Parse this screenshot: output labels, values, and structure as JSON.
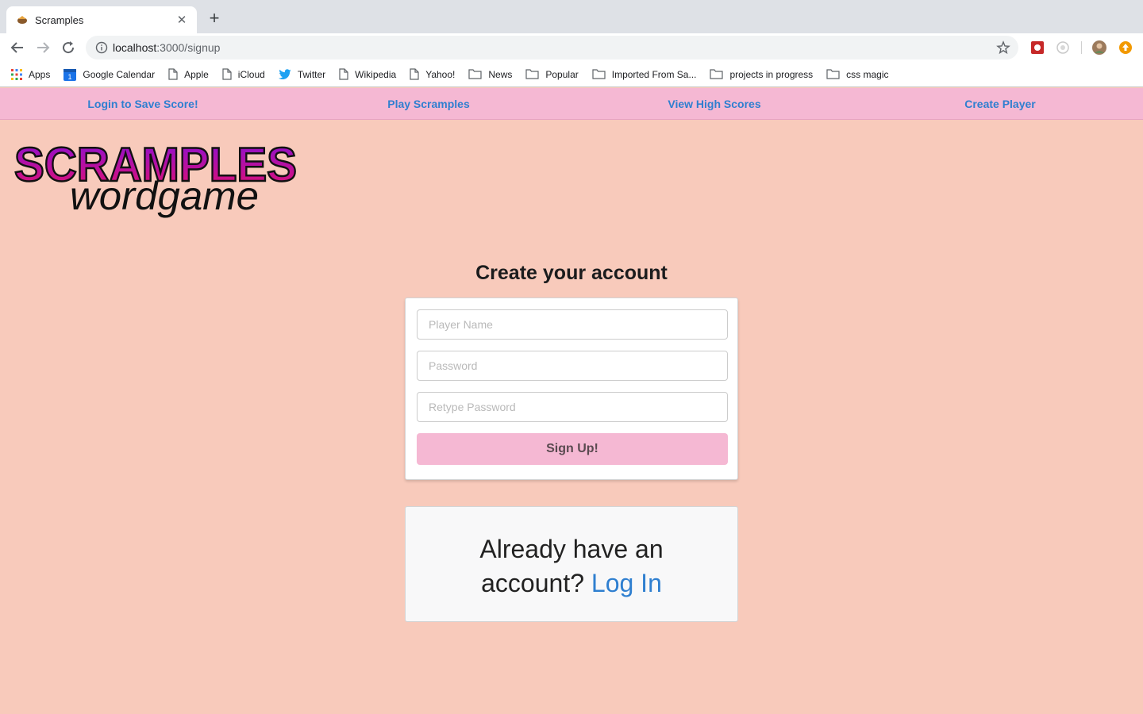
{
  "browser": {
    "tab_title": "Scramples",
    "new_tab_symbol": "+",
    "close_symbol": "✕",
    "url_host": "localhost",
    "url_path": ":3000/signup",
    "bookmarks": [
      "Apps",
      "Google Calendar",
      "Apple",
      "iCloud",
      "Twitter",
      "Wikipedia",
      "Yahoo!",
      "News",
      "Popular",
      "Imported From Sa...",
      "projects in progress",
      "css magic"
    ],
    "calendar_day": "1"
  },
  "nav": {
    "items": [
      "Login to Save Score!",
      "Play Scramples",
      "View High Scores",
      "Create Player"
    ]
  },
  "logo": {
    "title": "SCRAMPLES",
    "subtitle": "wordgame"
  },
  "signup": {
    "heading": "Create your account",
    "player_name_placeholder": "Player Name",
    "password_placeholder": "Password",
    "retype_placeholder": "Retype Password",
    "button": "Sign Up!"
  },
  "login_prompt": {
    "line1": "Already have an",
    "line2": "account? ",
    "link": "Log In"
  },
  "colors": {
    "page_bg": "#f8cabb",
    "nav_bg": "#f5b8d3",
    "link": "#2f7fd0",
    "logo_gradient_start": "#8a0fd6",
    "logo_gradient_end": "#e0116f"
  }
}
